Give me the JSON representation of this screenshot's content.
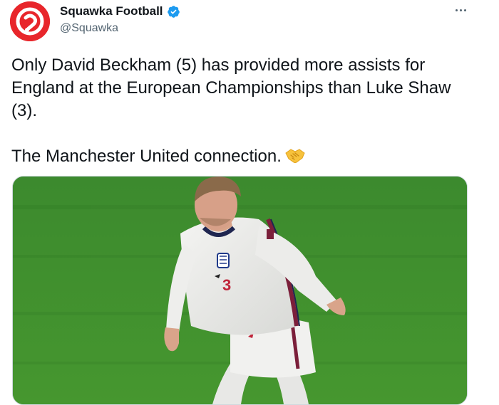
{
  "author": {
    "display_name": "Squawka Football",
    "handle": "@Squawka",
    "verified": true,
    "brand_color": "#e8262b"
  },
  "more_menu_icon": "more-horizontal-icon",
  "tweet": {
    "paragraph_1": "Only David Beckham (5) has provided more assists for England at the European Championships than Luke Shaw (3).",
    "paragraph_2": "The Manchester United connection.",
    "emoji": "handshake-icon"
  },
  "media": {
    "shirt_number": "3"
  },
  "colors": {
    "text": "#0f1419",
    "secondary": "#536471",
    "verified": "#1d9bf0",
    "pitch": "#3f8a31"
  }
}
